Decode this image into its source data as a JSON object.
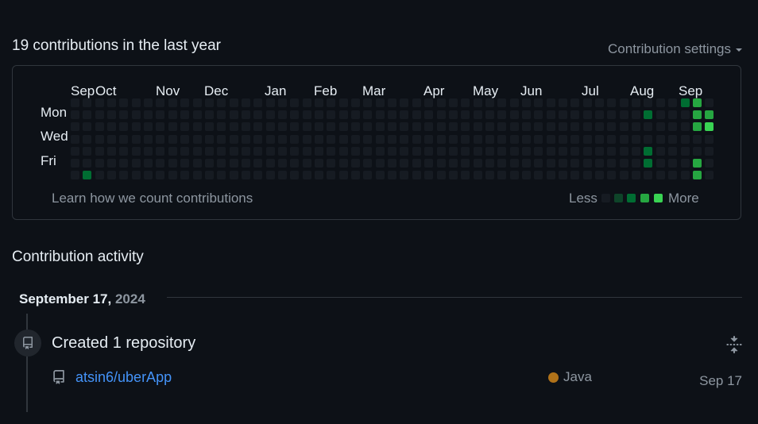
{
  "summary": {
    "heading": "19 contributions in the last year",
    "settings_label": "Contribution settings"
  },
  "calendar": {
    "months": [
      "Sep",
      "Oct",
      "Nov",
      "Dec",
      "Jan",
      "Feb",
      "Mar",
      "Apr",
      "May",
      "Jun",
      "Jul",
      "Aug",
      "Sep"
    ],
    "days": [
      "Mon",
      "Wed",
      "Fri"
    ],
    "learn_link": "Learn how we count contributions",
    "legend_less": "Less",
    "legend_more": "More",
    "colors": {
      "l0": "#161b22",
      "l1": "#0e4429",
      "l2": "#006d32",
      "l3": "#26a641",
      "l4": "#39d353"
    },
    "active_days": [
      {
        "week": 1,
        "day": 6,
        "level": 2
      },
      {
        "week": 47,
        "day": 1,
        "level": 2
      },
      {
        "week": 47,
        "day": 4,
        "level": 2
      },
      {
        "week": 47,
        "day": 5,
        "level": 2
      },
      {
        "week": 50,
        "day": 0,
        "level": 2
      },
      {
        "week": 51,
        "day": 0,
        "level": 3
      },
      {
        "week": 51,
        "day": 1,
        "level": 3
      },
      {
        "week": 51,
        "day": 2,
        "level": 3
      },
      {
        "week": 51,
        "day": 5,
        "level": 3
      },
      {
        "week": 51,
        "day": 6,
        "level": 3
      },
      {
        "week": 52,
        "day": 1,
        "level": 3
      },
      {
        "week": 52,
        "day": 2,
        "level": 4
      }
    ]
  },
  "activity": {
    "title": "Contribution activity",
    "date": "September 17,",
    "year": "2024",
    "event": {
      "title": "Created 1 repository",
      "repo_name": "atsin6/uberApp",
      "language": "Java",
      "language_color": "#b07219",
      "date": "Sep 17"
    }
  }
}
